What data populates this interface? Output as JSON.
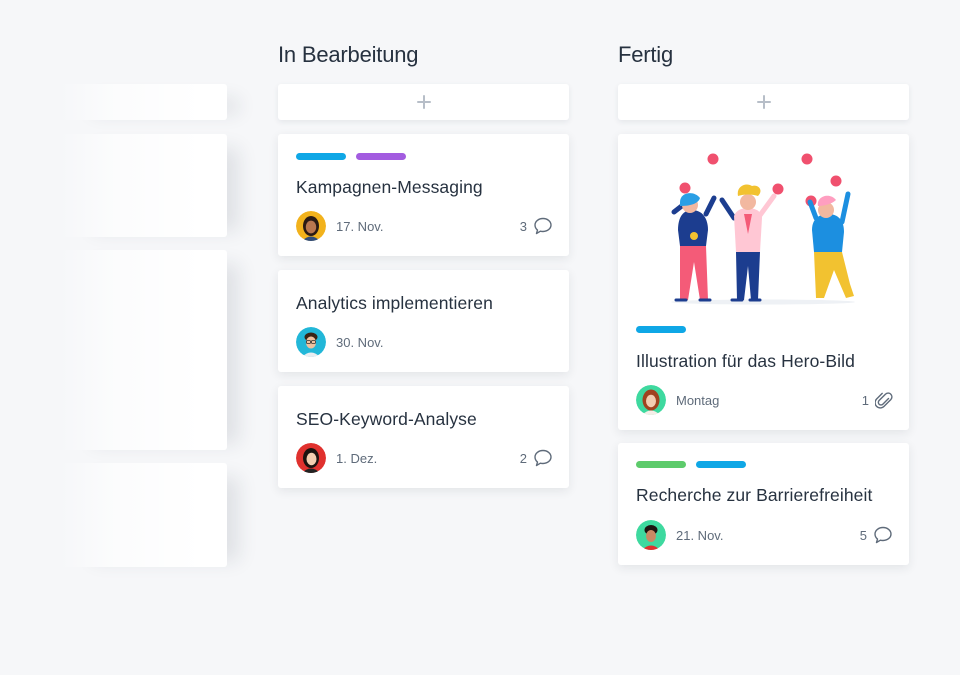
{
  "columns": [
    {
      "title": "In Bearbeitung",
      "cards": [
        {
          "title": "Kampagnen-Messaging",
          "date": "17. Nov.",
          "count": "3",
          "tags": [
            "#0fa7e6",
            "#a35ce0"
          ]
        },
        {
          "title": "Analytics implementieren",
          "date": "30. Nov."
        },
        {
          "title": "SEO-Keyword-Analyse",
          "date": "1. Dez.",
          "count": "2"
        }
      ]
    },
    {
      "title": "Fertig",
      "cards": [
        {
          "title": "Illustration für das Hero-Bild",
          "date": "Montag",
          "count": "1",
          "tags": [
            "#0fa7e6"
          ]
        },
        {
          "title": "Recherche zur Barrierefreiheit",
          "date": "21. Nov.",
          "count": "5",
          "tags": [
            "#5dcb6b",
            "#0fa7e6"
          ]
        }
      ]
    }
  ],
  "icons": {
    "add": "plus-icon",
    "comment": "comment-icon",
    "attachment": "paperclip-icon"
  },
  "colors": {
    "background": "#f6f7f9",
    "card": "#ffffff",
    "text": "#273240",
    "muted": "#5f6b7a",
    "tag_blue": "#0fa7e6",
    "tag_purple": "#a35ce0",
    "tag_green": "#5dcb6b"
  }
}
